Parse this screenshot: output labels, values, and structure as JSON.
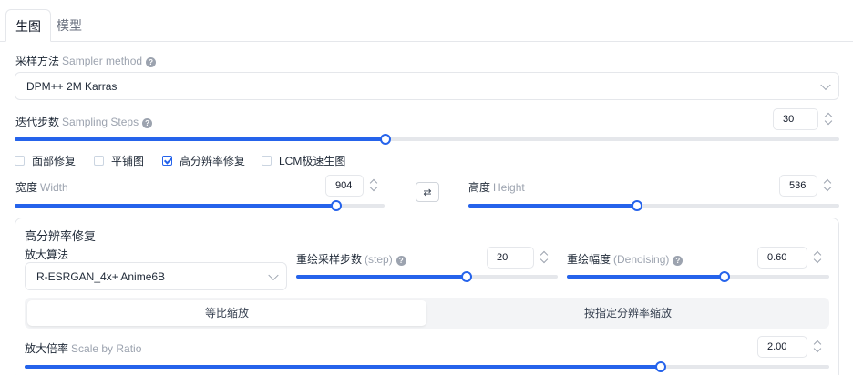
{
  "tabs": {
    "generate": "生图",
    "model": "模型"
  },
  "sampler": {
    "label": "采样方法",
    "label_en": "Sampler method",
    "value": "DPM++ 2M Karras"
  },
  "steps": {
    "label": "迭代步数",
    "label_en": "Sampling Steps",
    "value": "30",
    "fraction": 0.45
  },
  "options": [
    {
      "label": "面部修复",
      "checked": false
    },
    {
      "label": "平铺图",
      "checked": false
    },
    {
      "label": "高分辨率修复",
      "checked": true
    },
    {
      "label": "LCM极速生图",
      "checked": false
    }
  ],
  "width": {
    "label": "宽度",
    "label_en": "Width",
    "value": "904",
    "fraction": 0.87
  },
  "height": {
    "label": "高度",
    "label_en": "Height",
    "value": "536",
    "fraction": 0.455
  },
  "swap_icon": "⇄",
  "hires": {
    "title": "高分辨率修复",
    "upscaler": {
      "label": "放大算法",
      "value": "R-ESRGAN_4x+ Anime6B"
    },
    "hires_steps": {
      "label": "重绘采样步数",
      "label_en": "(step)",
      "value": "20",
      "fraction": 0.65
    },
    "denoising": {
      "label": "重绘幅度",
      "label_en": "(Denoising)",
      "value": "0.60",
      "fraction": 0.6
    },
    "modes": {
      "ratio": "等比缩放",
      "resolution": "按指定分辨率缩放"
    },
    "scale": {
      "label": "放大倍率",
      "label_en": "Scale by Ratio",
      "value": "2.00",
      "fraction": 0.79
    }
  },
  "colors": {
    "accent": "#2563eb"
  }
}
